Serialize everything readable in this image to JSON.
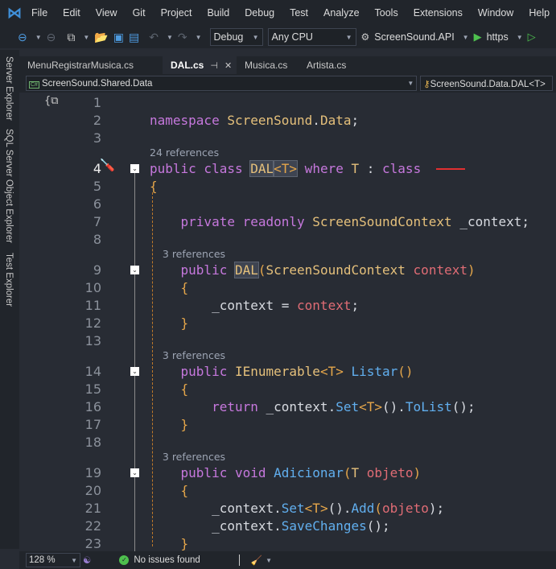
{
  "menu": [
    "File",
    "Edit",
    "View",
    "Git",
    "Project",
    "Build",
    "Debug",
    "Test",
    "Analyze",
    "Tools",
    "Extensions",
    "Window",
    "Help"
  ],
  "toolbar": {
    "config": "Debug",
    "platform": "Any CPU",
    "startup": "ScreenSound.API",
    "profile": "https"
  },
  "side_tabs": [
    "Server Explorer",
    "SQL Server Object Explorer",
    "Test Explorer"
  ],
  "tabs": [
    {
      "label": "MenuRegistrarMusica.cs"
    },
    {
      "label": "DAL.cs",
      "active": true
    },
    {
      "label": "Musica.cs"
    },
    {
      "label": "Artista.cs"
    }
  ],
  "navbar": {
    "project": "ScreenSound.Shared.Data",
    "type": "ScreenSound.Data.DAL<T>"
  },
  "code": [
    {
      "n": "1",
      "t": []
    },
    {
      "n": "2",
      "t": [
        [
          "namespace ",
          "kw"
        ],
        [
          "ScreenSound",
          "ty"
        ],
        [
          ".",
          "pl"
        ],
        [
          "Data",
          "ty"
        ],
        [
          ";",
          "pl"
        ]
      ]
    },
    {
      "n": "3",
      "t": []
    },
    {
      "refs": "24 references"
    },
    {
      "n": "4",
      "fold": true,
      "t": [
        [
          "public class ",
          "kw"
        ],
        [
          "DAL",
          "ty hl"
        ],
        [
          "<T>",
          "br hl"
        ],
        [
          " where ",
          "kw"
        ],
        [
          "T",
          "ty"
        ],
        [
          " : ",
          "pl"
        ],
        [
          "class",
          "kw"
        ]
      ]
    },
    {
      "n": "5",
      "t": [
        [
          "{",
          "br"
        ]
      ]
    },
    {
      "n": "6",
      "t": []
    },
    {
      "n": "7",
      "t": [
        [
          "    private readonly ",
          "kw"
        ],
        [
          "ScreenSoundContext",
          "ty"
        ],
        [
          " _context;",
          "pl"
        ]
      ]
    },
    {
      "n": "8",
      "t": []
    },
    {
      "refs": "    3 references"
    },
    {
      "n": "9",
      "fold": true,
      "t": [
        [
          "    public ",
          "kw"
        ],
        [
          "DAL",
          "ty hl"
        ],
        [
          "(",
          "br"
        ],
        [
          "ScreenSoundContext ",
          "ty"
        ],
        [
          "context",
          "pa"
        ],
        [
          ")",
          "br"
        ]
      ]
    },
    {
      "n": "10",
      "t": [
        [
          "    {",
          "br"
        ]
      ]
    },
    {
      "n": "11",
      "t": [
        [
          "        _context = ",
          "pl"
        ],
        [
          "context",
          "pa"
        ],
        [
          ";",
          "pl"
        ]
      ]
    },
    {
      "n": "12",
      "t": [
        [
          "    }",
          "br"
        ]
      ]
    },
    {
      "n": "13",
      "t": []
    },
    {
      "refs": "    3 references"
    },
    {
      "n": "14",
      "fold": true,
      "t": [
        [
          "    public ",
          "kw"
        ],
        [
          "IEnumerable",
          "ty"
        ],
        [
          "<T> ",
          "br"
        ],
        [
          "Listar",
          "fn"
        ],
        [
          "()",
          "br"
        ]
      ]
    },
    {
      "n": "15",
      "t": [
        [
          "    {",
          "br"
        ]
      ]
    },
    {
      "n": "16",
      "t": [
        [
          "        return ",
          "kw"
        ],
        [
          "_context.",
          "pl"
        ],
        [
          "Set",
          "fn"
        ],
        [
          "<T>",
          "br"
        ],
        [
          "().",
          "pl"
        ],
        [
          "ToList",
          "fn"
        ],
        [
          "();",
          "pl"
        ]
      ]
    },
    {
      "n": "17",
      "t": [
        [
          "    }",
          "br"
        ]
      ]
    },
    {
      "n": "18",
      "t": []
    },
    {
      "refs": "    3 references"
    },
    {
      "n": "19",
      "fold": true,
      "t": [
        [
          "    public void ",
          "kw"
        ],
        [
          "Adicionar",
          "fn"
        ],
        [
          "(",
          "br"
        ],
        [
          "T ",
          "ty"
        ],
        [
          "objeto",
          "pa"
        ],
        [
          ")",
          "br"
        ]
      ]
    },
    {
      "n": "20",
      "t": [
        [
          "    {",
          "br"
        ]
      ]
    },
    {
      "n": "21",
      "t": [
        [
          "        _context.",
          "pl"
        ],
        [
          "Set",
          "fn"
        ],
        [
          "<T>",
          "br"
        ],
        [
          "().",
          "pl"
        ],
        [
          "Add",
          "fn"
        ],
        [
          "(",
          "br"
        ],
        [
          "objeto",
          "pa"
        ],
        [
          ");",
          "pl"
        ]
      ]
    },
    {
      "n": "22",
      "t": [
        [
          "        _context.",
          "pl"
        ],
        [
          "SaveChanges",
          "fn"
        ],
        [
          "();",
          "pl"
        ]
      ]
    },
    {
      "n": "23",
      "t": [
        [
          "    }",
          "br"
        ]
      ]
    }
  ],
  "status": {
    "zoom": "128 %",
    "issues": "No issues found"
  }
}
